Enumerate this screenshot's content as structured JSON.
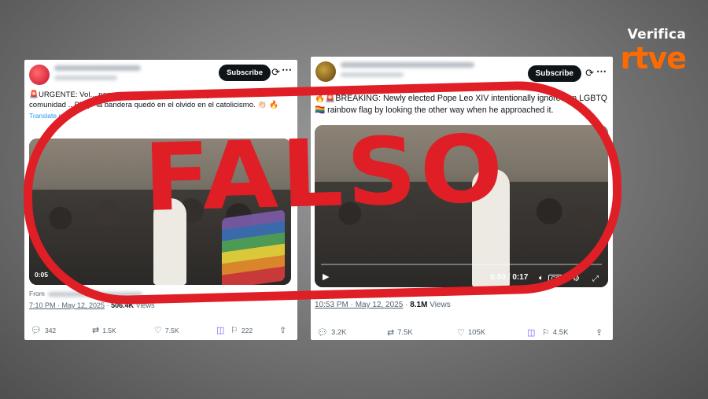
{
  "brand": {
    "top": "Verifica",
    "bottom": "rtve"
  },
  "overlay": {
    "label": "FALSO"
  },
  "colors": {
    "stamp": "#e01e26",
    "brand": "#ff6a00",
    "link": "#1d9bf0"
  },
  "left_post": {
    "subscribe": "Subscribe",
    "text": "🚨URGENTE: Vol... papa conservador... LEÓN XIV ignoró a los de la comunidad ...BTQ+ la bandera quedó en el olvido en el catolicismo. 👏🏻 🔥",
    "translate": "Translate post",
    "video_time": "0:05",
    "from_label": "From",
    "date": "7:10 PM · May 12, 2025",
    "views": "506.4K",
    "views_label": "Views",
    "replies": "342",
    "reposts": "1.5K",
    "likes": "7.5K",
    "bookmarks": "222"
  },
  "right_post": {
    "subscribe": "Subscribe",
    "text": "🔥🚨BREAKING: Newly elected Pope Leo XIV intentionally ignored an LGBTQ 🏳️‍🌈 rainbow flag by looking the other way when he approached it.",
    "video_time": "0:00 / 0:17",
    "date": "10:53 PM · May 12, 2025",
    "views": "8.1M",
    "views_label": "Views",
    "replies": "3.2K",
    "reposts": "7.5K",
    "likes": "105K",
    "bookmarks": "4.5K"
  }
}
